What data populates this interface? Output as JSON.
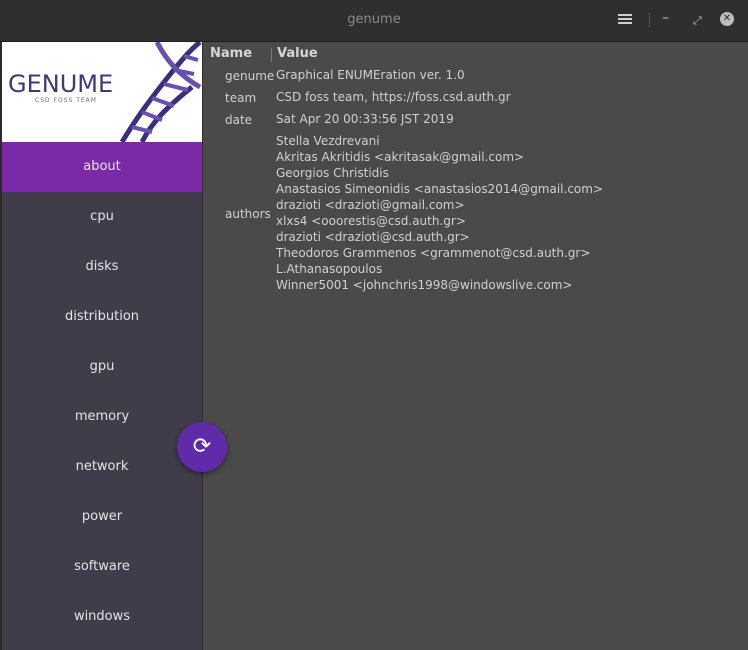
{
  "window": {
    "title": "genume",
    "menu_icon": "hamburger-menu-icon",
    "minimize_icon": "minimize-icon",
    "restore_icon": "restore-icon",
    "close_icon": "close-icon"
  },
  "sidebar": {
    "logo_text": "GENUME",
    "logo_subtitle": "CSD FOSS TEAM",
    "items": [
      {
        "label": "about",
        "active": true
      },
      {
        "label": "cpu",
        "active": false
      },
      {
        "label": "disks",
        "active": false
      },
      {
        "label": "distribution",
        "active": false
      },
      {
        "label": "gpu",
        "active": false
      },
      {
        "label": "memory",
        "active": false
      },
      {
        "label": "network",
        "active": false
      },
      {
        "label": "power",
        "active": false
      },
      {
        "label": "software",
        "active": false
      },
      {
        "label": "windows",
        "active": false
      }
    ]
  },
  "table": {
    "headers": {
      "name": "Name",
      "value": "Value"
    },
    "rows": [
      {
        "key": "genume",
        "values": [
          "Graphical ENUMEration ver. 1.0"
        ]
      },
      {
        "key": "team",
        "values": [
          "CSD foss team, https://foss.csd.auth.gr"
        ]
      },
      {
        "key": "date",
        "values": [
          "Sat Apr 20 00:33:56 JST 2019"
        ]
      },
      {
        "key": "authors",
        "values": [
          "Stella Vezdrevani",
          "Akritas Akritidis <akritasak@gmail.com>",
          "Georgios Christidis",
          "Anastasios Simeonidis <anastasios2014@gmail.com>",
          "drazioti <drazioti@gmail.com>",
          "xlxs4 <ooorestis@csd.auth.gr>",
          "drazioti <drazioti@csd.auth.gr>",
          "Theodoros Grammenos <grammenot@csd.auth.gr>",
          "L.Athanasopoulos",
          "Winner5001 <johnchris1998@windowslive.com>"
        ]
      }
    ]
  },
  "refresh_button": {
    "icon": "refresh-icon",
    "symbol": "⟳"
  },
  "colors": {
    "accent": "#7a2aa6",
    "fab": "#5f2ba8",
    "sidebar_bg": "#403c4a",
    "content_bg": "#4a4a4a"
  }
}
